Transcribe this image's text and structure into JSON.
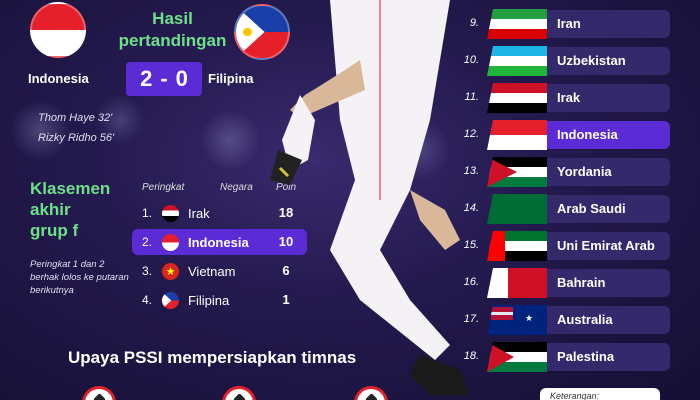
{
  "match": {
    "title_line1": "Hasil",
    "title_line2": "pertandingan",
    "home_team": "Indonesia",
    "away_team": "Filipina",
    "home_score": "2",
    "score_separator": "-",
    "away_score": "0",
    "scorers": [
      "Thom Haye 32'",
      "Rizky Ridho 56'"
    ]
  },
  "standings": {
    "title_line1": "Klasemen",
    "title_line2": "akhir",
    "title_line3": "grup f",
    "note": "Peringkat 1 dan 2 berhak lolos ke putaran berikutnya",
    "header_rank": "Peringkat",
    "header_country": "Negara",
    "header_points": "Poin",
    "rows": [
      {
        "rank": "1.",
        "country": "Irak",
        "points": "18",
        "flag": "flag-iraq",
        "highlight": false
      },
      {
        "rank": "2.",
        "country": "Indonesia",
        "points": "10",
        "flag": "flag-indonesia",
        "highlight": true
      },
      {
        "rank": "3.",
        "country": "Vietnam",
        "points": "6",
        "flag": "flag-vietnam",
        "highlight": false
      },
      {
        "rank": "4.",
        "country": "Filipina",
        "points": "1",
        "flag": "flag-philippines",
        "highlight": false
      }
    ]
  },
  "ranking": [
    {
      "rank": "9.",
      "country": "Iran",
      "flag": "flag-iran",
      "highlight": false
    },
    {
      "rank": "10.",
      "country": "Uzbekistan",
      "flag": "flag-uzbekistan",
      "highlight": false
    },
    {
      "rank": "11.",
      "country": "Irak",
      "flag": "flag-iraq",
      "highlight": false
    },
    {
      "rank": "12.",
      "country": "Indonesia",
      "flag": "flag-indonesia",
      "highlight": true
    },
    {
      "rank": "13.",
      "country": "Yordania",
      "flag": "flag-jordan",
      "highlight": false
    },
    {
      "rank": "14.",
      "country": "Arab Saudi",
      "flag": "flag-saudi",
      "highlight": false
    },
    {
      "rank": "15.",
      "country": "Uni Emirat Arab",
      "flag": "flag-uae",
      "highlight": false
    },
    {
      "rank": "16.",
      "country": "Bahrain",
      "flag": "flag-bahrain",
      "highlight": false
    },
    {
      "rank": "17.",
      "country": "Australia",
      "flag": "flag-australia",
      "highlight": false
    },
    {
      "rank": "18.",
      "country": "Palestina",
      "flag": "flag-palestine",
      "highlight": false
    }
  ],
  "footer": {
    "heading": "Upaya PSSI mempersiapkan timnas",
    "keterangan": "Keterangan:"
  },
  "colors": {
    "accent_green": "#6fe08a",
    "highlight_purple": "#5b2bd6",
    "row_bg": "#34296a",
    "background": "#241a4f"
  }
}
